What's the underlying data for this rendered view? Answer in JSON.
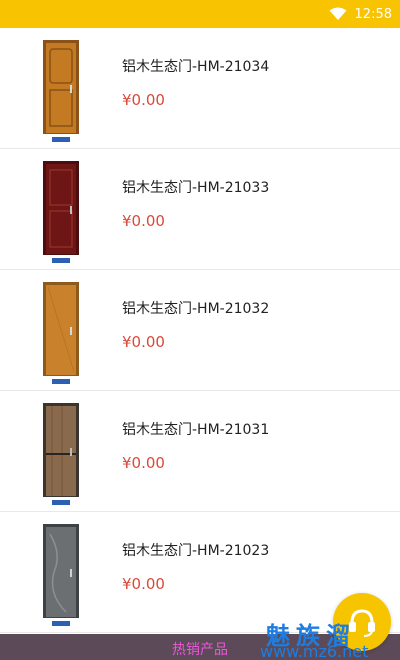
{
  "status_bar": {
    "time": "12:58",
    "wifi_icon": "wifi-icon"
  },
  "products": [
    {
      "title": "铝木生态门-HM-21034",
      "price": "¥0.00",
      "door_color": "#c47a22",
      "frame_color": "#8a5218"
    },
    {
      "title": "铝木生态门-HM-21033",
      "price": "¥0.00",
      "door_color": "#6e1616",
      "frame_color": "#4a0e0e"
    },
    {
      "title": "铝木生态门-HM-21032",
      "price": "¥0.00",
      "door_color": "#c9812c",
      "frame_color": "#8d5a1e"
    },
    {
      "title": "铝木生态门-HM-21031",
      "price": "¥0.00",
      "door_color": "#8a6a4c",
      "frame_color": "#3a342e"
    },
    {
      "title": "铝木生态门-HM-21023",
      "price": "¥0.00",
      "door_color": "#6b6f72",
      "frame_color": "#3e4245"
    }
  ],
  "bottom_bar": {
    "label": "热销产品"
  },
  "customer_service_icon": "headset-icon",
  "watermark": {
    "text_cn": "魅族溜",
    "url": "www.mz6.net"
  },
  "colors": {
    "status_bar": "#f8c300",
    "price": "#d84a3a",
    "bottom_bar": "#5d4a58",
    "bottom_label": "#e957d8",
    "fab": "#f7c400"
  }
}
